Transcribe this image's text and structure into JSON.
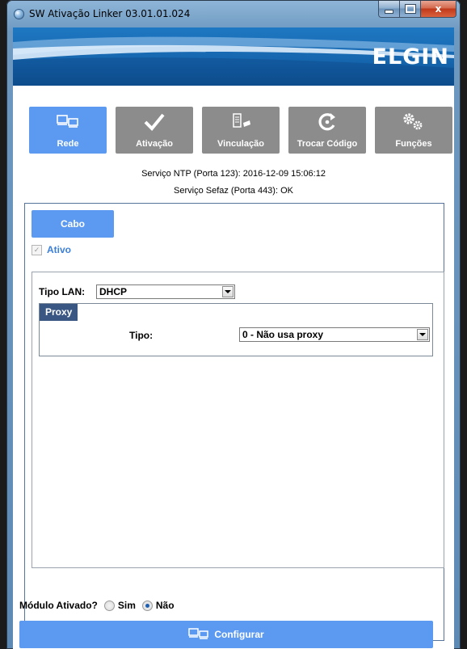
{
  "window": {
    "title": "SW Ativação Linker 03.01.01.024",
    "close_glyph": "x"
  },
  "banner": {
    "brand": "ELGIN"
  },
  "tiles": [
    {
      "label": "Rede",
      "icon": "monitors-icon",
      "active": true
    },
    {
      "label": "Ativação",
      "icon": "checkmark-icon",
      "active": false
    },
    {
      "label": "Vinculação",
      "icon": "link-device-icon",
      "active": false
    },
    {
      "label": "Trocar Código",
      "icon": "refresh-icon",
      "active": false
    },
    {
      "label": "Funções",
      "icon": "gears-icon",
      "active": false
    }
  ],
  "status": {
    "ntp": "Serviço NTP (Porta 123): 2016-12-09 15:06:12",
    "sefaz": "Serviço Sefaz (Porta 443): OK"
  },
  "network": {
    "cabo_label": "Cabo",
    "ativo_label": "Ativo",
    "ativo_checked": true,
    "tipo_lan_label": "Tipo LAN:",
    "tipo_lan_value": "DHCP",
    "proxy": {
      "header": "Proxy",
      "tipo_label": "Tipo:",
      "tipo_value": "0 - Não usa proxy"
    }
  },
  "footer": {
    "modulo_label": "Módulo Ativado?",
    "sim_label": "Sim",
    "nao_label": "Não",
    "selected": "Não",
    "configurar_label": "Configurar"
  },
  "colors": {
    "accent": "#5b9af0",
    "tile_inactive": "#8c8c8c",
    "proxy_header": "#3a5784",
    "ativo_text": "#3b7fd9"
  }
}
